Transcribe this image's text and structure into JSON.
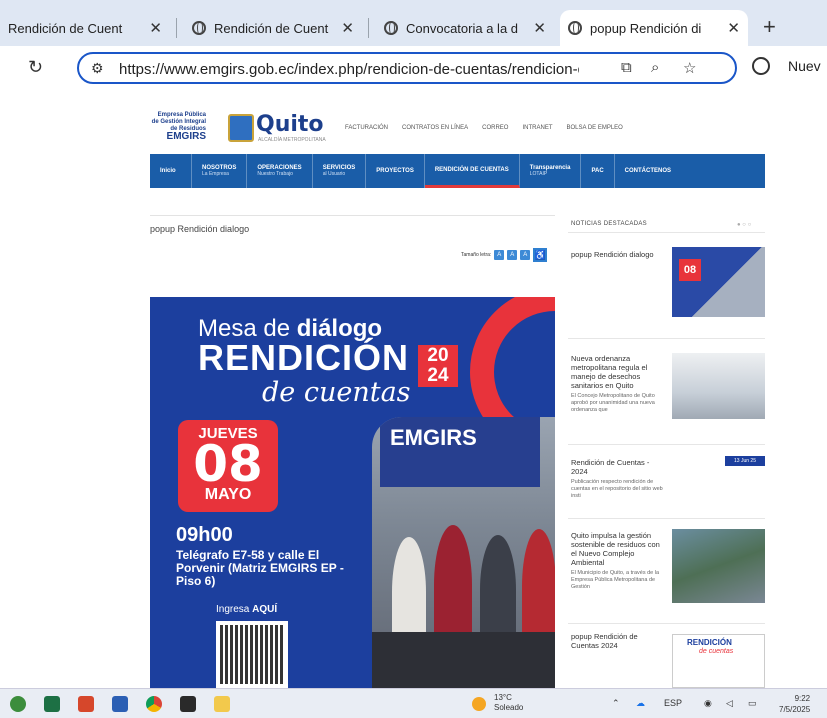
{
  "browser": {
    "tabs": [
      {
        "title": "Rendición de Cuent",
        "active": false
      },
      {
        "title": "Rendición de Cuent",
        "active": false
      },
      {
        "title": "Convocatoria a la d",
        "active": false
      },
      {
        "title": "popup Rendición di",
        "active": true
      }
    ],
    "new_tab": "+",
    "url": "https://www.emgirs.gob.ec/index.php/rendicion-de-cuentas/rendicion-de-cu",
    "right_label": "Nuev"
  },
  "site": {
    "logo_text": "Empresa Pública de Gestión Integral de Residuos",
    "logo_name": "EMGIRS",
    "city": "Quito",
    "city_sub": "ALCALDÍA METROPOLITANA",
    "top_links": [
      "FACTURACIÓN",
      "CONTRATOS EN LÍNEA",
      "CORREO",
      "INTRANET",
      "BOLSA DE EMPLEO"
    ],
    "nav": [
      {
        "label": "Inicio",
        "sub": ""
      },
      {
        "label": "NOSOTROS",
        "sub": "La Empresa"
      },
      {
        "label": "OPERACIONES",
        "sub": "Nuestro Trabajo"
      },
      {
        "label": "SERVICIOS",
        "sub": "al Usuario"
      },
      {
        "label": "PROYECTOS",
        "sub": ""
      },
      {
        "label": "RENDICIÓN DE CUENTAS",
        "sub": ""
      },
      {
        "label": "Transparencia",
        "sub": "LOTAIP"
      },
      {
        "label": "PAC",
        "sub": ""
      },
      {
        "label": "CONTÁCTENOS",
        "sub": ""
      }
    ],
    "active_nav": "RENDICIÓN DE CUENTAS"
  },
  "article": {
    "title": "popup Rendición dialogo",
    "text_size_label": "Tamaño letra:"
  },
  "poster": {
    "mesa": "Mesa de",
    "mesa_bold": "diálogo",
    "rendicion": "RENDICIÓN",
    "year_top": "20",
    "year_bottom": "24",
    "cuentas": "de cuentas",
    "day_name": "JUEVES",
    "day": "08",
    "month": "MAYO",
    "time": "09h00",
    "address": "Telégrafo E7-58 y calle El Porvenir (Matriz EMGIRS EP - Piso 6)",
    "ingresa": "Ingresa",
    "ingresa_bold": "AQUÍ",
    "photo_sign": "EMGIRS"
  },
  "sidebar": {
    "heading": "NOTICIAS DESTACADAS",
    "news": [
      {
        "title": "popup Rendición dialogo",
        "desc": ""
      },
      {
        "title": "Nueva ordenanza metropolitana regula el manejo de desechos sanitarios en Quito",
        "desc": "El Concejo Metropolitano de Quito aprobó por unanimidad una nueva ordenanza que"
      },
      {
        "title": "Rendición de Cuentas - 2024",
        "desc": "Publicación respecto rendición de cuentas en el repositorio del sitio web insti",
        "badge": "13 Jun 25"
      },
      {
        "title": "Quito impulsa la gestión sostenible de residuos con el Nuevo Complejo Ambiental",
        "desc": "El Municipio de Quito, a través de la Empresa Pública Metropolitana de Gestión"
      },
      {
        "title": "popup Rendición de Cuentas 2024",
        "desc": ""
      }
    ],
    "thumb1_day": "08",
    "thumb5_title": "RENDICIÓN",
    "thumb5_sub": "de cuentas"
  },
  "taskbar": {
    "temp": "13°C",
    "weather": "Soleado",
    "lang": "ESP",
    "time": "9:22",
    "date": "7/5/2025"
  }
}
